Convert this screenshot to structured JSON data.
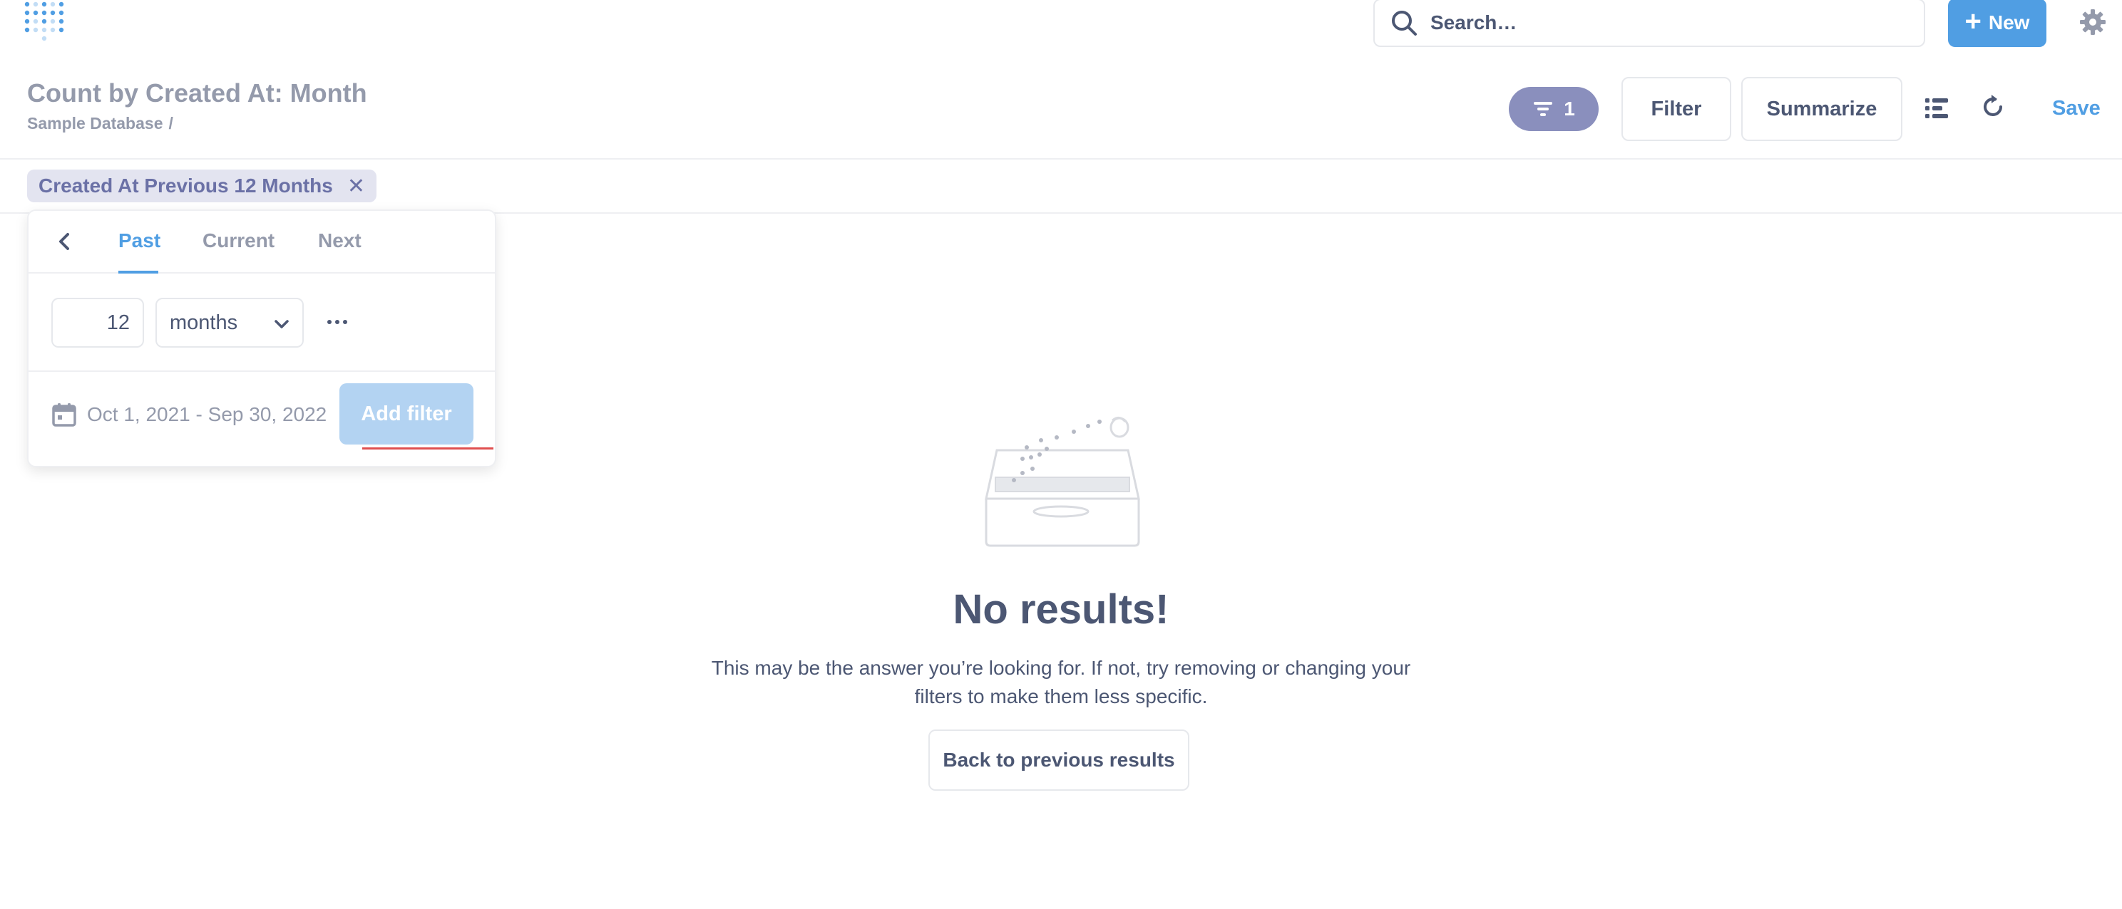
{
  "nav": {
    "logo_icon": "metabase-logo-icon",
    "search_placeholder": "Search…",
    "search_icon": "search-icon",
    "new_label": "New",
    "settings_icon": "gear-icon"
  },
  "header": {
    "title": "Count by Created At: Month",
    "breadcrumb": "Sample Database",
    "breadcrumb_sep": "/",
    "filter_count": "1",
    "filter_label": "Filter",
    "summarize_label": "Summarize",
    "save_label": "Save"
  },
  "filter_chip": {
    "label": "Created At Previous 12 Months",
    "close_glyph": "✕"
  },
  "popover": {
    "tabs": [
      "Past",
      "Current",
      "Next"
    ],
    "active_tab": "Past",
    "amount": "12",
    "unit": "months",
    "date_range": "Oct 1, 2021 - Sep 30, 2022",
    "add_filter_label": "Add filter"
  },
  "empty_state": {
    "title": "No results!",
    "description": "This may be the answer you’re looking for. If not, try removing or changing your filters to make them less specific.",
    "back_label": "Back to previous results"
  },
  "colors": {
    "brand": "#509ee3",
    "filter_purple": "#8a8fbd",
    "text": "#4c5773",
    "muted": "#949aab"
  }
}
